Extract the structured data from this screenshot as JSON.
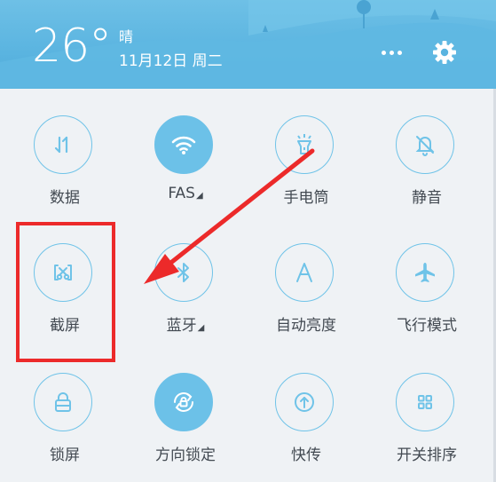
{
  "status": {
    "temperature": "26°",
    "weather": "晴",
    "date": "11月12日 周二"
  },
  "header": {
    "more_icon": "more-dots-icon",
    "settings_icon": "gear-icon"
  },
  "tiles": [
    {
      "label": "数据",
      "icon": "mobile-data-icon",
      "active": false,
      "dropdown": false
    },
    {
      "label": "FAS",
      "icon": "wifi-icon",
      "active": true,
      "dropdown": true
    },
    {
      "label": "手电筒",
      "icon": "flashlight-icon",
      "active": false,
      "dropdown": false
    },
    {
      "label": "静音",
      "icon": "bell-muted-icon",
      "active": false,
      "dropdown": false
    },
    {
      "label": "截屏",
      "icon": "screenshot-scissors-icon",
      "active": false,
      "dropdown": false
    },
    {
      "label": "蓝牙",
      "icon": "bluetooth-icon",
      "active": false,
      "dropdown": true
    },
    {
      "label": "自动亮度",
      "icon": "auto-brightness-icon",
      "active": false,
      "dropdown": false
    },
    {
      "label": "飞行模式",
      "icon": "airplane-icon",
      "active": false,
      "dropdown": false
    },
    {
      "label": "锁屏",
      "icon": "lock-icon",
      "active": false,
      "dropdown": false
    },
    {
      "label": "方向锁定",
      "icon": "rotation-lock-icon",
      "active": true,
      "dropdown": false
    },
    {
      "label": "快传",
      "icon": "quick-transfer-icon",
      "active": false,
      "dropdown": false
    },
    {
      "label": "开关排序",
      "icon": "grid-sort-icon",
      "active": false,
      "dropdown": false
    }
  ],
  "colors": {
    "accent": "#6cc1e8",
    "header": "#5ab4e0",
    "annotation": "#ec2a2a"
  }
}
